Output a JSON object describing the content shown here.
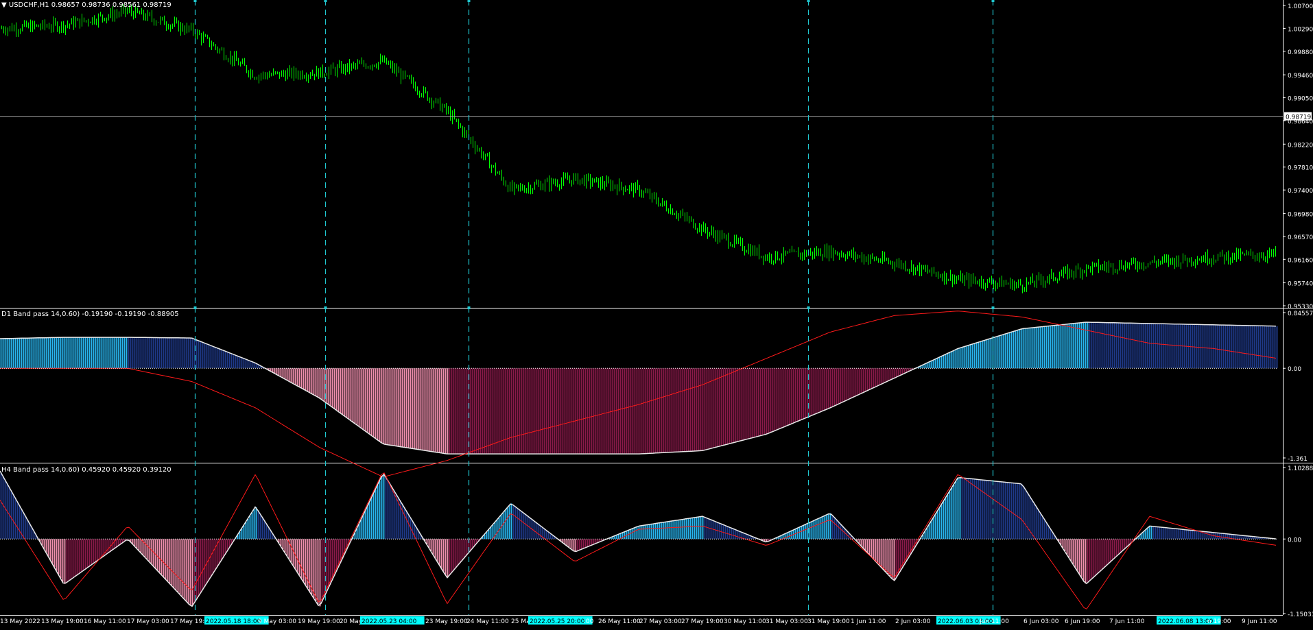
{
  "colors": {
    "background": "#000000",
    "bull_candle": "#00ff00",
    "bear_candle": "#00ff00",
    "axis": "#ffffff",
    "separator": "#ffffff",
    "vline": "#20c8d0",
    "hist_pos_light": "#29b6f0",
    "hist_pos_dark": "#1f3a8a",
    "hist_neg_light": "#f08fae",
    "hist_neg_dark": "#8a1a4a",
    "signal_line": "#ff1a1a",
    "band_line": "#e8e8e8",
    "price_line": "#a0a0a0",
    "price_box_bg": "#ffffff",
    "price_box_fg": "#000000",
    "highlight_bg": "#00ffff",
    "highlight_fg": "#000000"
  },
  "main": {
    "title": "USDCHF,H1  0.98657 0.98736 0.98561 0.98719",
    "current_price": "0.98719",
    "y_ticks": [
      "1.00700",
      "1.00290",
      "0.99880",
      "0.99460",
      "0.99050",
      "0.98640",
      "0.98220",
      "0.97810",
      "0.97400",
      "0.96980",
      "0.96570",
      "0.96160",
      "0.95740",
      "0.95330"
    ]
  },
  "d1": {
    "title": "D1 Band pass 14,0.60) -0.19190 -0.19190 -0.88905",
    "y_ticks": [
      "0.84557",
      "0.00",
      "-1.361"
    ]
  },
  "h4": {
    "title": "H4 Band pass 14,0.60) 0.45920 0.45920 0.39120",
    "y_ticks": [
      "1.10288",
      "0.00",
      "-1.15033"
    ]
  },
  "x_axis": {
    "labels": [
      "13 May 2022",
      "13 May 19:00",
      "16 May 11:00",
      "17 May 03:00",
      "17 May 19:00",
      "2022.05.18 18:00",
      "9 May 03:00",
      "19 May 19:00",
      "20 May",
      "2022.05.23 04:00",
      "23 May 19:00",
      "24 May 11:00",
      "25 May",
      "2022.05.25 20:00",
      ":00",
      "26 May 11:00",
      "27 May 03:00",
      "27 May 19:00",
      "30 May 11:00",
      "31 May 03:00",
      "31 May 19:00",
      "1 Jun 11:00",
      "2 Jun 03:00",
      "2022.06.03 03:00",
      "Jun 11:00",
      "6 Jun 03:00",
      "6 Jun 19:00",
      "7 Jun 11:00",
      "2022.06.08 13:00",
      "n 19:00",
      "9 Jun 11:00"
    ],
    "highlighted": [
      "2022.05.18 18:00",
      "2022.05.23 04:00",
      "2022.05.25 20:00",
      "2022.06.03 03:00",
      "2022.06.08 13:00"
    ]
  },
  "chart_data": [
    {
      "type": "line",
      "title": "USDCHF,H1  0.98657 0.98736 0.98561 0.98719",
      "x": [
        0,
        5,
        10,
        15,
        20,
        25,
        30,
        35,
        40,
        45,
        50,
        55,
        60,
        65,
        70,
        75,
        80,
        85,
        90,
        95,
        100
      ],
      "series": [
        {
          "name": "USDCHF,H1",
          "values": [
            1.0029,
            1.0035,
            1.006,
            1.0025,
            0.9945,
            0.995,
            0.997,
            0.988,
            0.974,
            0.976,
            0.974,
            0.967,
            0.962,
            0.963,
            0.961,
            0.958,
            0.957,
            0.96,
            0.961,
            0.962,
            0.9625
          ]
        }
      ],
      "ylim": [
        0.9533,
        1.007
      ]
    },
    {
      "type": "bar",
      "title": "D1 Band pass 14,0.60) -0.19190 -0.19190 -0.88905",
      "x": [
        0,
        5,
        10,
        15,
        20,
        25,
        30,
        35,
        40,
        45,
        50,
        55,
        60,
        65,
        70,
        75,
        80,
        85,
        90,
        95,
        100
      ],
      "series": [
        {
          "values": [
            0.45,
            0.47,
            0.47,
            0.46,
            0.08,
            -0.45,
            -1.15,
            -1.3,
            -1.3,
            -1.3,
            -1.3,
            -1.25,
            -1.0,
            -0.6,
            -0.15,
            0.3,
            0.6,
            0.7,
            0.68,
            0.66,
            0.64
          ]
        },
        {
          "values": [
            0.0,
            0.0,
            0.0,
            -0.2,
            -0.6,
            -1.2,
            -1.65,
            -1.4,
            -1.05,
            -0.8,
            -0.55,
            -0.25,
            0.15,
            0.55,
            0.8,
            0.87,
            0.78,
            0.58,
            0.38,
            0.3,
            0.15
          ]
        }
      ],
      "ylim": [
        -1.361,
        0.84557
      ]
    },
    {
      "type": "bar",
      "title": "H4 Band pass 14,0.60) 0.45920 0.45920 0.39120",
      "x": [
        0,
        5,
        10,
        15,
        20,
        25,
        30,
        35,
        40,
        45,
        50,
        55,
        60,
        65,
        70,
        75,
        80,
        85,
        90,
        95,
        100
      ],
      "series": [
        {
          "values": [
            1.05,
            -0.7,
            0.0,
            -1.05,
            0.5,
            -1.05,
            1.02,
            -0.6,
            0.55,
            -0.2,
            0.2,
            0.35,
            -0.05,
            0.4,
            -0.65,
            0.95,
            0.85,
            -0.7,
            0.2,
            0.1,
            0.0
          ]
        },
        {
          "values": [
            0.6,
            -0.95,
            0.2,
            -0.8,
            1.0,
            -1.0,
            1.05,
            -1.0,
            0.4,
            -0.35,
            0.15,
            0.2,
            -0.1,
            0.3,
            -0.6,
            1.0,
            0.3,
            -1.1,
            0.35,
            0.05,
            -0.1
          ]
        }
      ],
      "ylim": [
        -1.15033,
        1.10288
      ]
    }
  ]
}
